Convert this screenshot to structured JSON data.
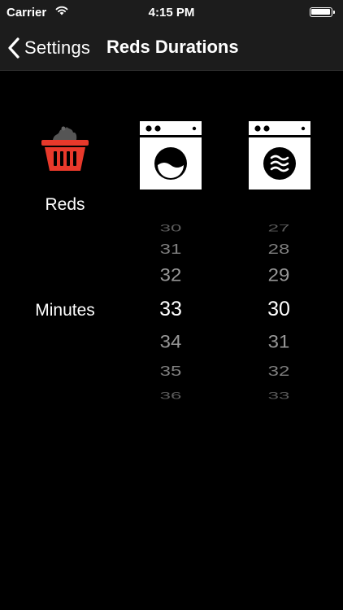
{
  "status_bar": {
    "carrier": "Carrier",
    "time": "4:15 PM",
    "wifi_icon": "wifi-icon",
    "battery_icon": "battery-icon"
  },
  "nav": {
    "back_label": "Settings",
    "title": "Reds Durations"
  },
  "category": {
    "label": "Reds",
    "icon": "laundry-basket-icon",
    "icon_color": "#e8392b"
  },
  "units_label": "Minutes",
  "washer_picker": {
    "icon": "washing-machine-icon",
    "values": [
      "30",
      "31",
      "32",
      "33",
      "34",
      "35",
      "36"
    ],
    "selected": "33"
  },
  "dryer_picker": {
    "icon": "dryer-machine-icon",
    "values": [
      "27",
      "28",
      "29",
      "30",
      "31",
      "32",
      "33"
    ],
    "selected": "30"
  }
}
